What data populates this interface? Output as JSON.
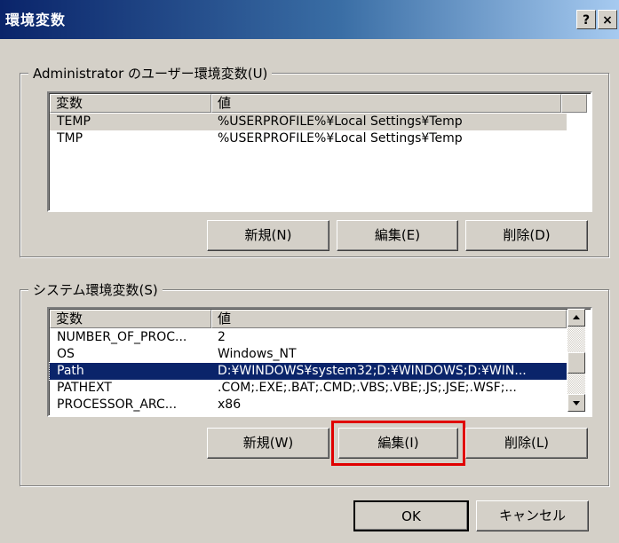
{
  "window": {
    "title": "環境変数",
    "help_label": "?",
    "close_label": "×"
  },
  "user_group": {
    "legend": "Administrator のユーザー環境変数(U)",
    "columns": [
      "変数",
      "値"
    ],
    "rows": [
      {
        "name": "TEMP",
        "value": "%USERPROFILE%¥Local Settings¥Temp"
      },
      {
        "name": "TMP",
        "value": "%USERPROFILE%¥Local Settings¥Temp"
      }
    ],
    "buttons": {
      "new": "新規(N)",
      "edit": "編集(E)",
      "delete": "削除(D)"
    }
  },
  "system_group": {
    "legend": "システム環境変数(S)",
    "columns": [
      "変数",
      "値"
    ],
    "rows": [
      {
        "name": "NUMBER_OF_PROC...",
        "value": "2"
      },
      {
        "name": "OS",
        "value": "Windows_NT"
      },
      {
        "name": "Path",
        "value": "D:¥WINDOWS¥system32;D:¥WINDOWS;D:¥WIN..."
      },
      {
        "name": "PATHEXT",
        "value": ".COM;.EXE;.BAT;.CMD;.VBS;.VBE;.JS;.JSE;.WSF;..."
      },
      {
        "name": "PROCESSOR_ARC...",
        "value": "x86"
      }
    ],
    "buttons": {
      "new": "新規(W)",
      "edit": "編集(I)",
      "delete": "削除(L)"
    }
  },
  "dialog_buttons": {
    "ok": "OK",
    "cancel": "キャンセル"
  },
  "colors": {
    "title_bar": "#0a246a",
    "selection": "#0a246a",
    "highlight": "#e00000",
    "face": "#d4d0c8"
  }
}
